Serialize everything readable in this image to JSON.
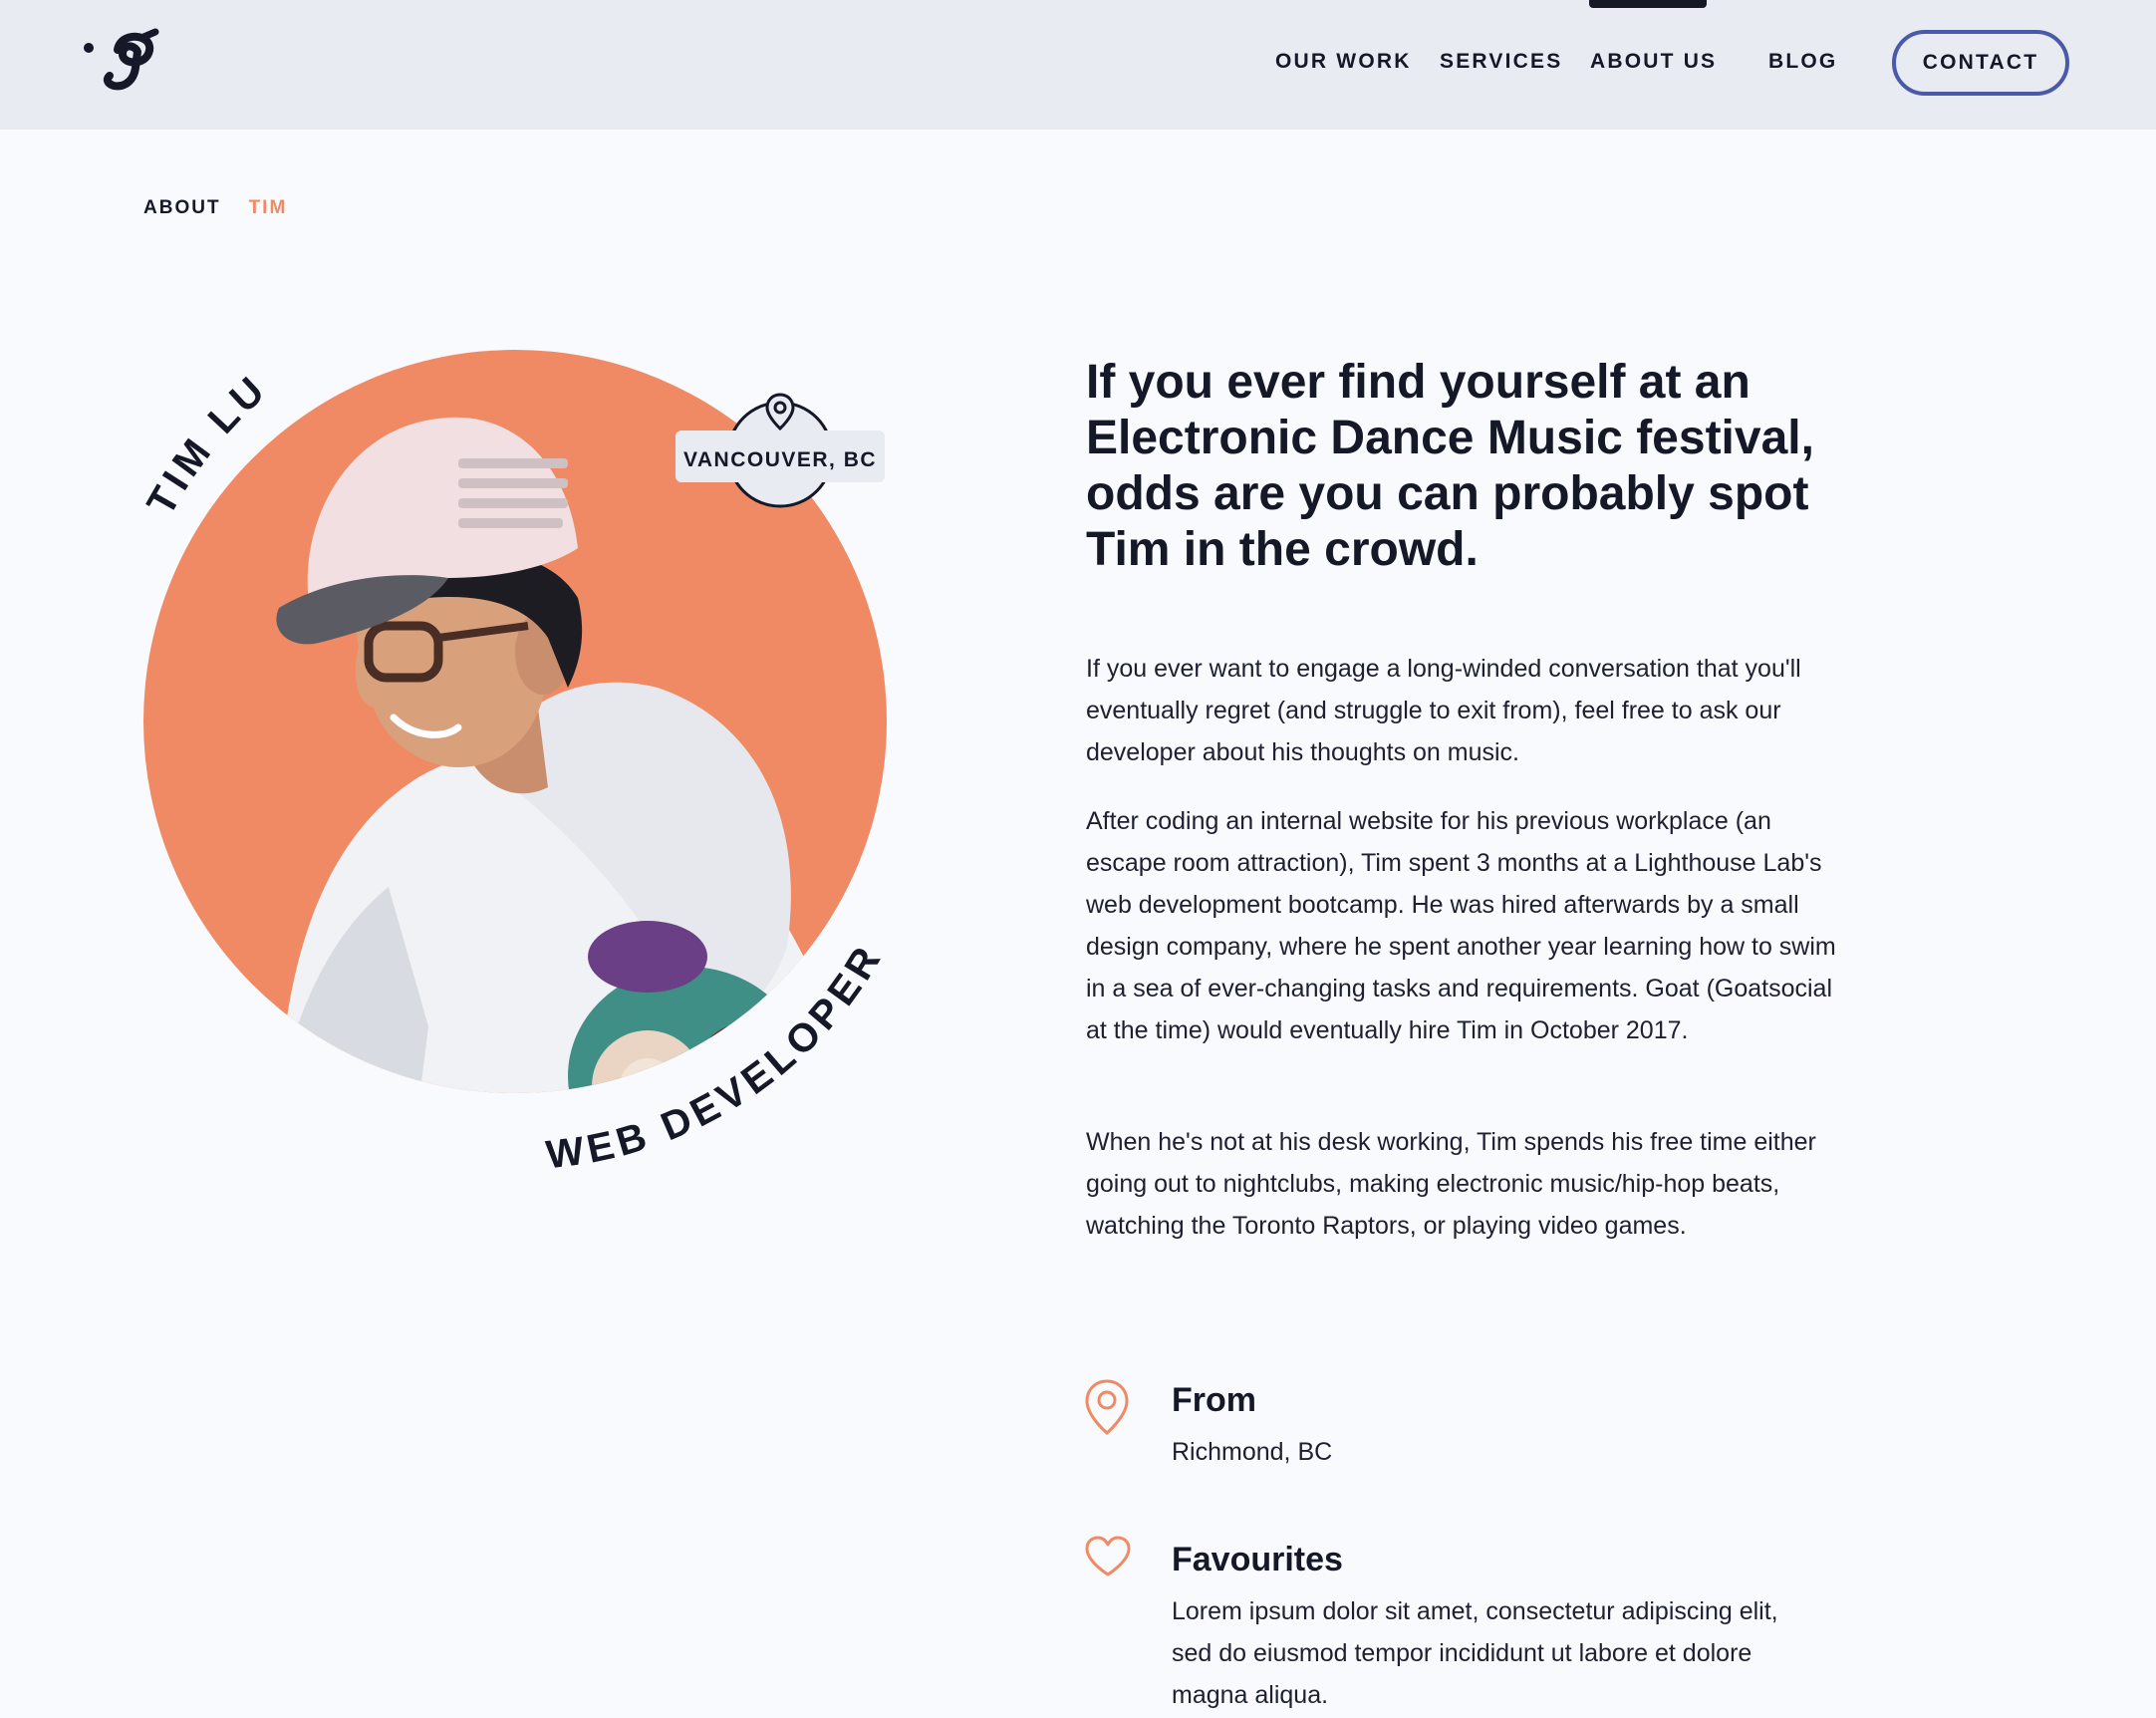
{
  "header": {
    "logo_name": "g-logo",
    "nav": [
      {
        "label": "OUR WORK"
      },
      {
        "label": "SERVICES"
      },
      {
        "label": "ABOUT US",
        "active": true
      },
      {
        "label": "BLOG"
      }
    ],
    "contact_label": "CONTACT"
  },
  "breadcrumb": {
    "parent": "ABOUT",
    "current": "TIM"
  },
  "profile": {
    "name": "TIM LU",
    "role": "WEB DEVELOPER",
    "location": "VANCOUVER, BC",
    "accent_color": "#ef8a64",
    "photo_description": "person-in-cap-and-hoodie"
  },
  "content": {
    "headline": "If you ever find yourself at an Electronic Dance Music festival, odds are you can probably spot Tim in the crowd.",
    "paragraphs": [
      "If you ever want to engage a long-winded conversation that you'll eventually regret (and struggle to exit from), feel free to ask our developer about his thoughts on music.",
      "After coding an internal website for his previous workplace (an escape room attraction), Tim spent 3 months at a Lighthouse Lab's web development bootcamp. He was hired afterwards by a small design company, where he spent another year learning how to swim in a sea of ever-changing tasks and requirements. Goat (Goatsocial at the time) would eventually hire Tim in October 2017.",
      "When he's not at his desk working, Tim spends his free time either going out to nightclubs, making electronic music/hip-hop beats, watching the Toronto Raptors, or playing video games."
    ]
  },
  "facts": {
    "from": {
      "icon": "map-pin-icon",
      "title": "From",
      "text": "Richmond, BC"
    },
    "favourites": {
      "icon": "heart-icon",
      "title": "Favourites",
      "text": "Lorem ipsum dolor sit amet, consectetur adipiscing elit, sed do eiusmod tempor incididunt ut labore et dolore magna aliqua."
    }
  }
}
